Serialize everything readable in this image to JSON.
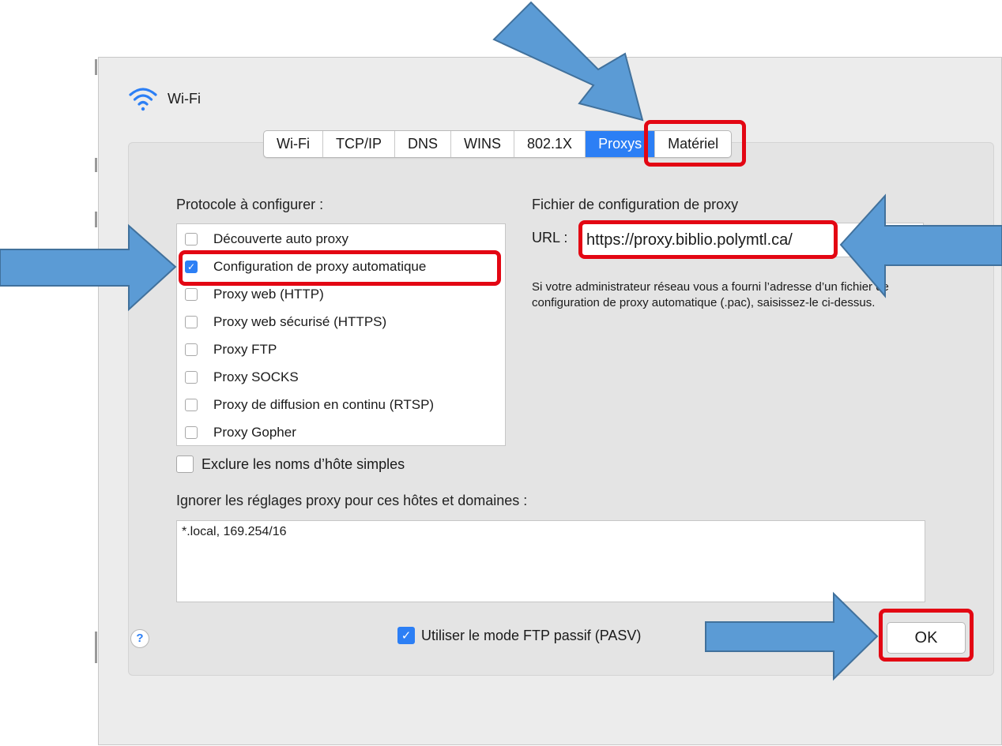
{
  "colors": {
    "accent": "#2c7ff5",
    "highlight": "#e30613",
    "arrow": "#5b9bd5",
    "arrow_stroke": "#41719c"
  },
  "window": {
    "title": "Wi-Fi",
    "icon": "wifi-icon"
  },
  "tabs": [
    {
      "label": "Wi-Fi"
    },
    {
      "label": "TCP/IP"
    },
    {
      "label": "DNS"
    },
    {
      "label": "WINS"
    },
    {
      "label": "802.1X"
    },
    {
      "label": "Proxys",
      "active": true
    },
    {
      "label": "Matériel"
    }
  ],
  "protocols": {
    "heading": "Protocole à configurer :",
    "items": [
      {
        "label": "Découverte auto proxy",
        "checked": false
      },
      {
        "label": "Configuration de proxy automatique",
        "checked": true
      },
      {
        "label": "Proxy web (HTTP)",
        "checked": false
      },
      {
        "label": "Proxy web sécurisé (HTTPS)",
        "checked": false
      },
      {
        "label": "Proxy FTP",
        "checked": false
      },
      {
        "label": "Proxy SOCKS",
        "checked": false
      },
      {
        "label": "Proxy de diffusion en continu (RTSP)",
        "checked": false
      },
      {
        "label": "Proxy Gopher",
        "checked": false
      }
    ]
  },
  "pac": {
    "heading": "Fichier de configuration de proxy",
    "url_label": "URL :",
    "url_value": "https://proxy.biblio.polymtl.ca/",
    "help_text": "Si votre administrateur réseau vous a fourni l’adresse d’un fichier de configuration de proxy automatique (.pac), saisissez-le ci-dessus."
  },
  "exclude_simple": {
    "label": "Exclure les noms d’hôte simples",
    "checked": false
  },
  "bypass": {
    "label": "Ignorer les réglages proxy pour ces hôtes et domaines :",
    "value": "*.local, 169.254/16"
  },
  "passive_ftp": {
    "label": "Utiliser le mode FTP passif (PASV)",
    "checked": true
  },
  "footer": {
    "help_glyph": "?",
    "ok_label": "OK"
  }
}
